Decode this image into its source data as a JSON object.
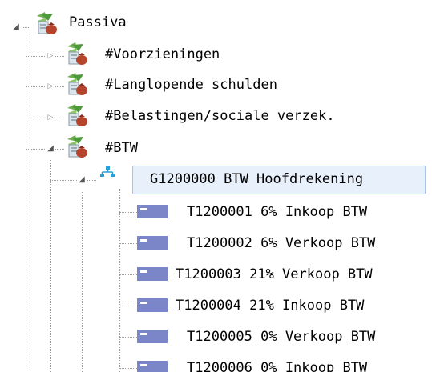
{
  "tree": {
    "root": {
      "label": "Passiva",
      "expanded": true,
      "icon": "plant-folder-icon"
    },
    "groups": [
      {
        "label": "#Voorzieningen",
        "expanded": false,
        "icon": "plant-folder-icon"
      },
      {
        "label": "#Langlopende schulden",
        "expanded": false,
        "icon": "plant-folder-icon"
      },
      {
        "label": "#Belastingen/sociale verzek.",
        "expanded": false,
        "icon": "plant-folder-icon"
      },
      {
        "label": "#BTW",
        "expanded": true,
        "icon": "plant-folder-icon"
      }
    ],
    "main_account": {
      "label": "G1200000 BTW Hoofdrekening",
      "expanded": true,
      "selected": true,
      "icon": "hierarchy-icon"
    },
    "sub_accounts": [
      {
        "label": "T1200001 6% Inkoop BTW",
        "icon": "account-card-icon"
      },
      {
        "label": "T1200002 6% Verkoop BTW",
        "icon": "account-card-icon"
      },
      {
        "label": "T1200003 21% Verkoop BTW",
        "icon": "account-card-icon"
      },
      {
        "label": "T1200004 21% Inkoop BTW",
        "icon": "account-card-icon"
      },
      {
        "label": "T1200005 0% Verkoop BTW",
        "icon": "account-card-icon"
      },
      {
        "label": "T1200006 0% Inkoop BTW",
        "icon": "account-card-icon"
      }
    ],
    "colors": {
      "selection_background": "#e8f0fb",
      "selection_border": "#aac4e8",
      "account_icon": "#7b86c9",
      "hierarchy_icon": "#2a9fd6"
    }
  }
}
